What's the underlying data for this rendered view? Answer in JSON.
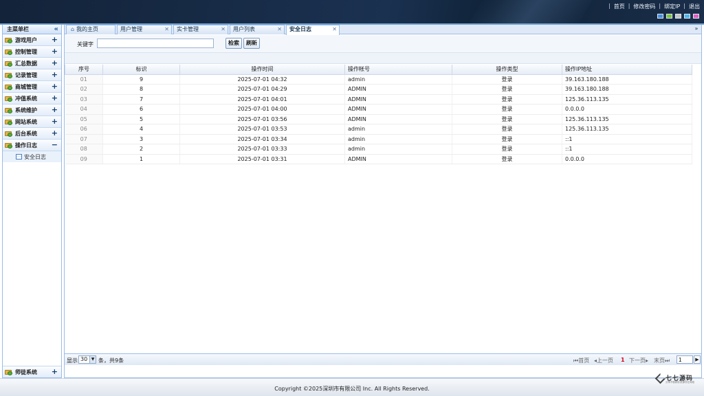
{
  "header": {
    "links": [
      "首页",
      "修改密码",
      "绑定IP",
      "退出"
    ],
    "swatches": [
      "#4a90d9",
      "#7cc243",
      "#c4c4c4",
      "#4fb5e8",
      "#e05fbf"
    ]
  },
  "sidebar": {
    "title": "主菜单栏",
    "collapse_icon": "double-chevron-left",
    "items": [
      {
        "label": "游戏用户",
        "toggle": "+"
      },
      {
        "label": "控制管理",
        "toggle": "+"
      },
      {
        "label": "汇总数据",
        "toggle": "+"
      },
      {
        "label": "记录管理",
        "toggle": "+"
      },
      {
        "label": "商城管理",
        "toggle": "+"
      },
      {
        "label": "冲值系统",
        "toggle": "+"
      },
      {
        "label": "系统维护",
        "toggle": "+"
      },
      {
        "label": "网站系统",
        "toggle": "+"
      },
      {
        "label": "后台系统",
        "toggle": "+"
      },
      {
        "label": "操作日志",
        "toggle": "−"
      }
    ],
    "sub_items": [
      {
        "label": "安全日志"
      }
    ],
    "bottom_item": {
      "label": "师徒系统",
      "toggle": "+"
    }
  },
  "tabs": [
    {
      "label": "我的主页",
      "closable": false
    },
    {
      "label": "用户管理",
      "closable": true
    },
    {
      "label": "实卡管理",
      "closable": true
    },
    {
      "label": "用户列表",
      "closable": true
    },
    {
      "label": "安全日志",
      "closable": true,
      "active": true
    }
  ],
  "search": {
    "label": "关键字",
    "value": "",
    "search_button": "检索",
    "refresh_button": "刷新"
  },
  "table": {
    "columns": [
      "序号",
      "标识",
      "操作时间",
      "操作帐号",
      "操作类型",
      "操作IP地址"
    ],
    "rows": [
      [
        "01",
        "9",
        "2025-07-01 04:32",
        "admin",
        "登录",
        "39.163.180.188"
      ],
      [
        "02",
        "8",
        "2025-07-01 04:29",
        "ADMIN",
        "登录",
        "39.163.180.188"
      ],
      [
        "03",
        "7",
        "2025-07-01 04:01",
        "ADMIN",
        "登录",
        "125.36.113.135"
      ],
      [
        "04",
        "6",
        "2025-07-01 04:00",
        "ADMIN",
        "登录",
        "0.0.0.0"
      ],
      [
        "05",
        "5",
        "2025-07-01 03:56",
        "ADMIN",
        "登录",
        "125.36.113.135"
      ],
      [
        "06",
        "4",
        "2025-07-01 03:53",
        "admin",
        "登录",
        "125.36.113.135"
      ],
      [
        "07",
        "3",
        "2025-07-01 03:34",
        "admin",
        "登录",
        "::1"
      ],
      [
        "08",
        "2",
        "2025-07-01 03:33",
        "admin",
        "登录",
        "::1"
      ],
      [
        "09",
        "1",
        "2025-07-01 03:31",
        "ADMIN",
        "登录",
        "0.0.0.0"
      ]
    ]
  },
  "pager": {
    "show_label": "显示",
    "page_size": "30",
    "count_text": "条，共9条",
    "first": "首页",
    "prev": "上一页",
    "current": "1",
    "next": "下一页",
    "last": "末页",
    "page_input": "1"
  },
  "footer": {
    "copyright": "Copyright ©2025深圳市有限公司 Inc. All Rights Reserved.",
    "watermark_title": "七七源码",
    "watermark_sub": "分享不断精彩资源尽在网络"
  }
}
